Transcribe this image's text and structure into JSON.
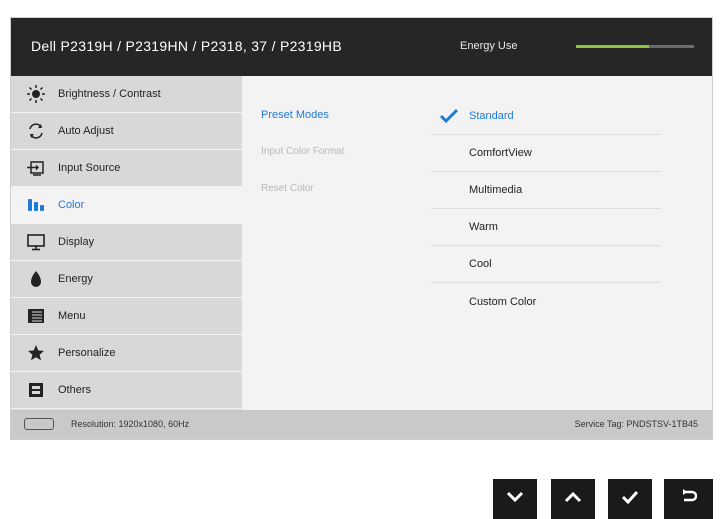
{
  "header": {
    "title": "Dell P2319H / P2319HN / P2318, 37 / P2319HB",
    "energy_label": "Energy Use",
    "energy_level": 0.62,
    "energy_color": "#8cc63f"
  },
  "menu": [
    {
      "label": "Brightness / Contrast",
      "icon": "sun-icon"
    },
    {
      "label": "Auto Adjust",
      "icon": "auto-adjust-icon"
    },
    {
      "label": "Input Source",
      "icon": "input-source-icon"
    },
    {
      "label": "Color",
      "icon": "color-icon",
      "selected": true
    },
    {
      "label": "Display",
      "icon": "monitor-icon"
    },
    {
      "label": "Energy",
      "icon": "energy-icon"
    },
    {
      "label": "Menu",
      "icon": "menu-icon"
    },
    {
      "label": "Personalize",
      "icon": "star-icon"
    },
    {
      "label": "Others",
      "icon": "others-icon"
    }
  ],
  "submenu": [
    "Preset Modes",
    "Input Color Format",
    "Reset Color"
  ],
  "options": [
    "Standard",
    "ComfortView",
    "Multimedia",
    "Warm",
    "Cool",
    "Custom Color"
  ],
  "footer": {
    "resolution": "Resolution: 1920x1080, 60Hz",
    "service_tag": "Service Tag: PNDSTSV-1TB45"
  },
  "nav_buttons": [
    "down-icon",
    "up-icon",
    "check-icon",
    "back-icon"
  ]
}
